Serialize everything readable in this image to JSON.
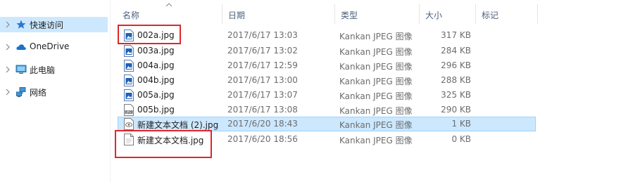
{
  "nav": {
    "items": [
      {
        "label": "快速访问",
        "icon": "star-icon",
        "selected": true
      },
      {
        "label": "OneDrive",
        "icon": "cloud-icon",
        "selected": false
      },
      {
        "label": "此电脑",
        "icon": "computer-icon",
        "selected": false
      },
      {
        "label": "网络",
        "icon": "network-icon",
        "selected": false
      }
    ]
  },
  "columns": {
    "name": "名称",
    "date": "日期",
    "type": "类型",
    "size": "大小",
    "tags": "标记"
  },
  "files": [
    {
      "name": "002a.jpg",
      "date": "2017/6/17 13:03",
      "type": "Kankan JPEG 图像",
      "size": "317 KB",
      "icon": "image-file-icon"
    },
    {
      "name": "003a.jpg",
      "date": "2017/6/17 13:02",
      "type": "Kankan JPEG 图像",
      "size": "284 KB",
      "icon": "image-file-icon"
    },
    {
      "name": "004a.jpg",
      "date": "2017/6/17 12:59",
      "type": "Kankan JPEG 图像",
      "size": "296 KB",
      "icon": "image-file-icon"
    },
    {
      "name": "004b.jpg",
      "date": "2017/6/17 13:00",
      "type": "Kankan JPEG 图像",
      "size": "288 KB",
      "icon": "image-file-icon"
    },
    {
      "name": "005a.jpg",
      "date": "2017/6/17 13:07",
      "type": "Kankan JPEG 图像",
      "size": "325 KB",
      "icon": "image-file-icon"
    },
    {
      "name": "005b.jpg",
      "date": "2017/6/17 13:08",
      "type": "Kankan JPEG 图像",
      "size": "290 KB",
      "icon": "jpg-file-icon"
    },
    {
      "name": "新建文本文档 (2).jpg",
      "date": "2017/6/20 18:43",
      "type": "Kankan JPEG 图像",
      "size": "1 KB",
      "icon": "eye-file-icon",
      "selected": true
    },
    {
      "name": "新建文本文档.jpg",
      "date": "2017/6/20 18:56",
      "type": "Kankan JPEG 图像",
      "size": "0 KB",
      "icon": "blank-file-icon"
    }
  ],
  "colors": {
    "selection": "#cce8ff",
    "selection_border": "#99d1ff",
    "annotation": "#e0262b",
    "header_text": "#4c607a",
    "meta_text": "#6d6d6d"
  }
}
